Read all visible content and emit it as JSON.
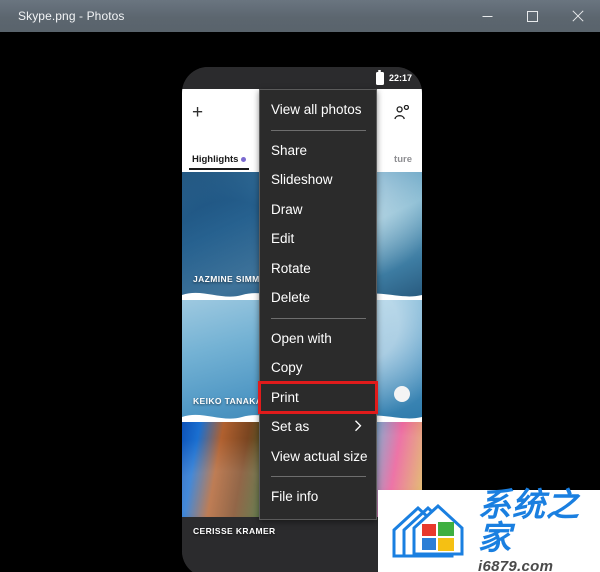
{
  "window": {
    "title": "Skype.png - Photos",
    "controls": [
      {
        "name": "minimize",
        "label": "—"
      },
      {
        "name": "maximize",
        "label": "□"
      },
      {
        "name": "close",
        "label": "✕"
      }
    ]
  },
  "photo": {
    "statusbar": {
      "time": "22:17",
      "battery_icon": "battery-icon"
    },
    "app": {
      "add_icon": "plus-icon",
      "add_person_icon": "add-person-icon",
      "tabs": [
        {
          "label": "Highlights",
          "active": true,
          "dot": true
        },
        {
          "label": "ture",
          "active": false,
          "dot": false
        }
      ]
    },
    "stories": [
      {
        "name": "JAZMINE SIMMONS"
      },
      {
        "name": "KEIKO TANAKA"
      },
      {
        "name": "CERISSE KRAMER"
      }
    ]
  },
  "context_menu": {
    "highlight_color": "#e01b1b",
    "highlighted_item": "Print",
    "items": [
      {
        "label": "View all photos",
        "separator_after": true
      },
      {
        "label": "Share"
      },
      {
        "label": "Slideshow"
      },
      {
        "label": "Draw"
      },
      {
        "label": "Edit"
      },
      {
        "label": "Rotate"
      },
      {
        "label": "Delete",
        "separator_after": true
      },
      {
        "label": "Open with"
      },
      {
        "label": "Copy"
      },
      {
        "label": "Print",
        "highlighted": true
      },
      {
        "label": "Set as",
        "submenu": true,
        "chevron": "›"
      },
      {
        "label": "View actual size",
        "separator_after": true
      },
      {
        "label": "File info"
      }
    ]
  },
  "watermark": {
    "brand": "系统之家",
    "url": "i6879.com",
    "logo_icon": "house-windows-logo"
  }
}
